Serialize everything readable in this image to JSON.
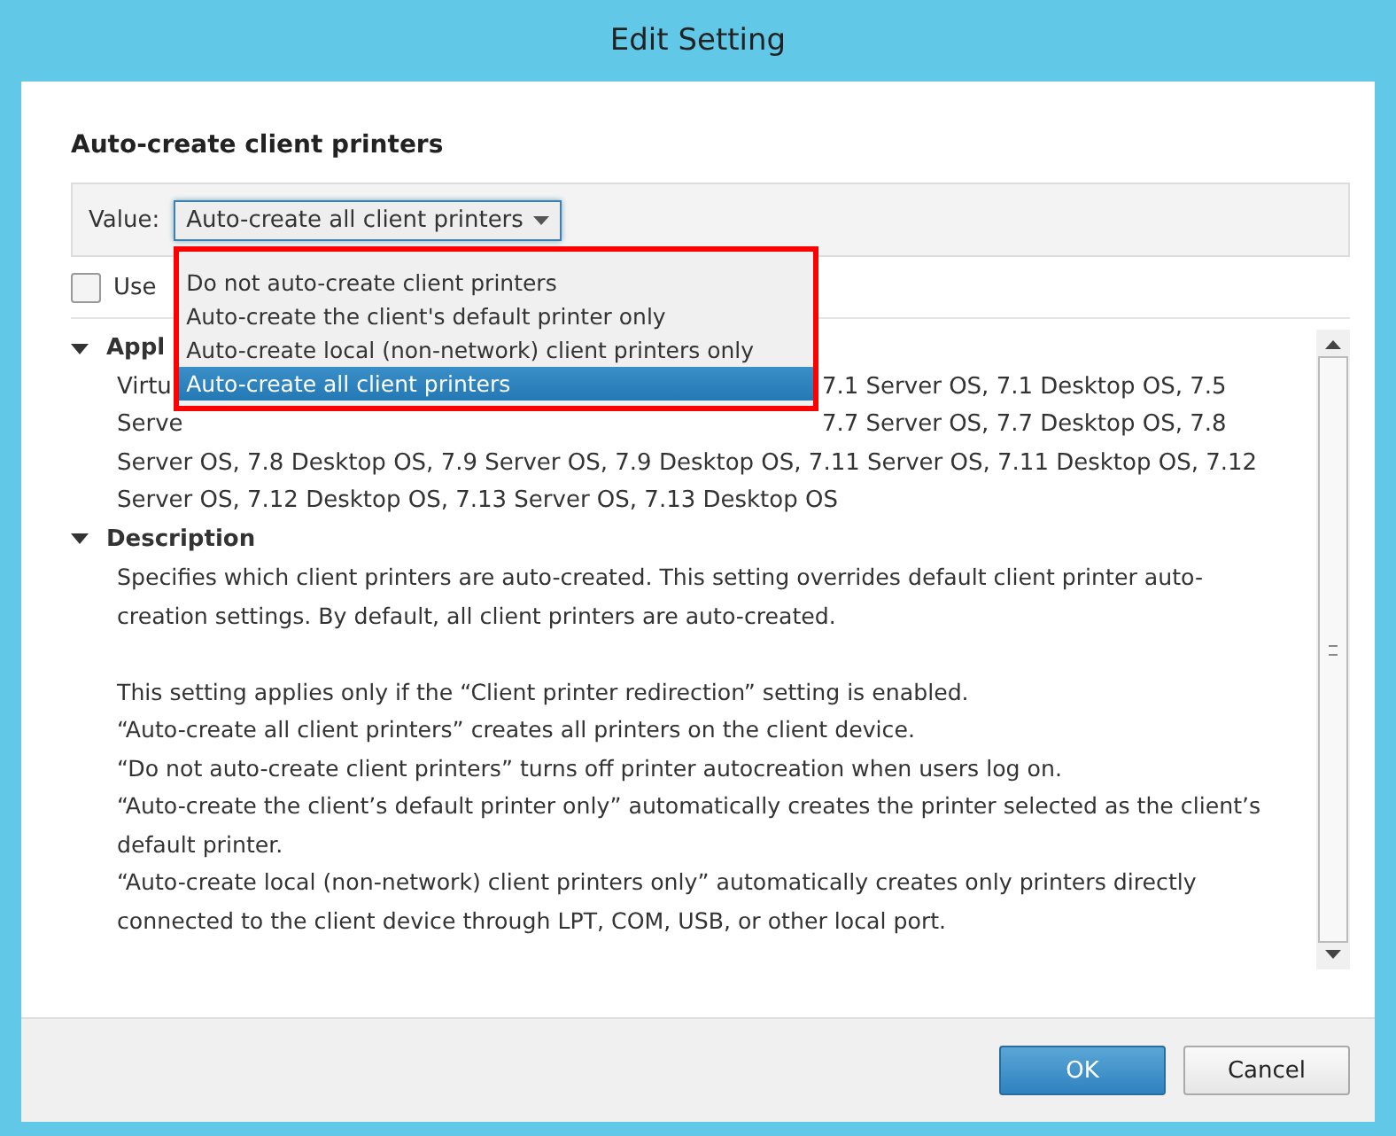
{
  "window": {
    "title": "Edit Setting"
  },
  "setting": {
    "title": "Auto-create client printers"
  },
  "value": {
    "label": "Value:",
    "selected_text": "Auto-create all client printers",
    "expanded": true
  },
  "dropdown": {
    "outlined": true,
    "options": [
      {
        "label": "Do not auto-create client printers",
        "selected": false
      },
      {
        "label": "Auto-create the client's default printer only",
        "selected": false
      },
      {
        "label": "Auto-create local (non-network) client printers only",
        "selected": false
      },
      {
        "label": "Auto-create all client printers",
        "selected": true
      }
    ]
  },
  "use_default": {
    "label": "Use",
    "checked": false
  },
  "applies_to": {
    "heading": "Appl",
    "expanded": true,
    "lines": [
      {
        "left": "Virtu",
        "right": "7.1 Server OS, 7.1 Desktop OS, 7.5"
      },
      {
        "left": "Serve",
        "right": "7.7 Server OS, 7.7 Desktop OS, 7.8"
      },
      {
        "left": "Server OS, 7.8 Desktop OS, 7.9 Server OS, 7.9 Desktop OS, 7.11 Server OS, 7.11 Desktop OS, 7.12"
      },
      {
        "left": "Server OS, 7.12 Desktop OS, 7.13 Server OS, 7.13 Desktop OS"
      }
    ]
  },
  "description": {
    "heading": "Description",
    "expanded": true,
    "paragraphs": [
      "Specifies which client printers are auto-created. This setting overrides default client printer auto-creation settings. By default, all client printers are auto-created.",
      "This setting applies only if the “Client printer redirection” setting is enabled.\n“Auto-create all client printers” creates all printers on the client device.\n“Do not auto-create client printers” turns off printer autocreation when users log on.\n“Auto-create the client’s default printer only” automatically creates the printer selected as the client’s default printer.\n“Auto-create local (non-network) client printers only” automatically creates only printers directly connected to the client device through LPT, COM, USB, or other local port."
    ]
  },
  "buttons": [
    {
      "label": "OK",
      "kind": "primary"
    },
    {
      "label": "Cancel",
      "kind": "secondary"
    }
  ]
}
